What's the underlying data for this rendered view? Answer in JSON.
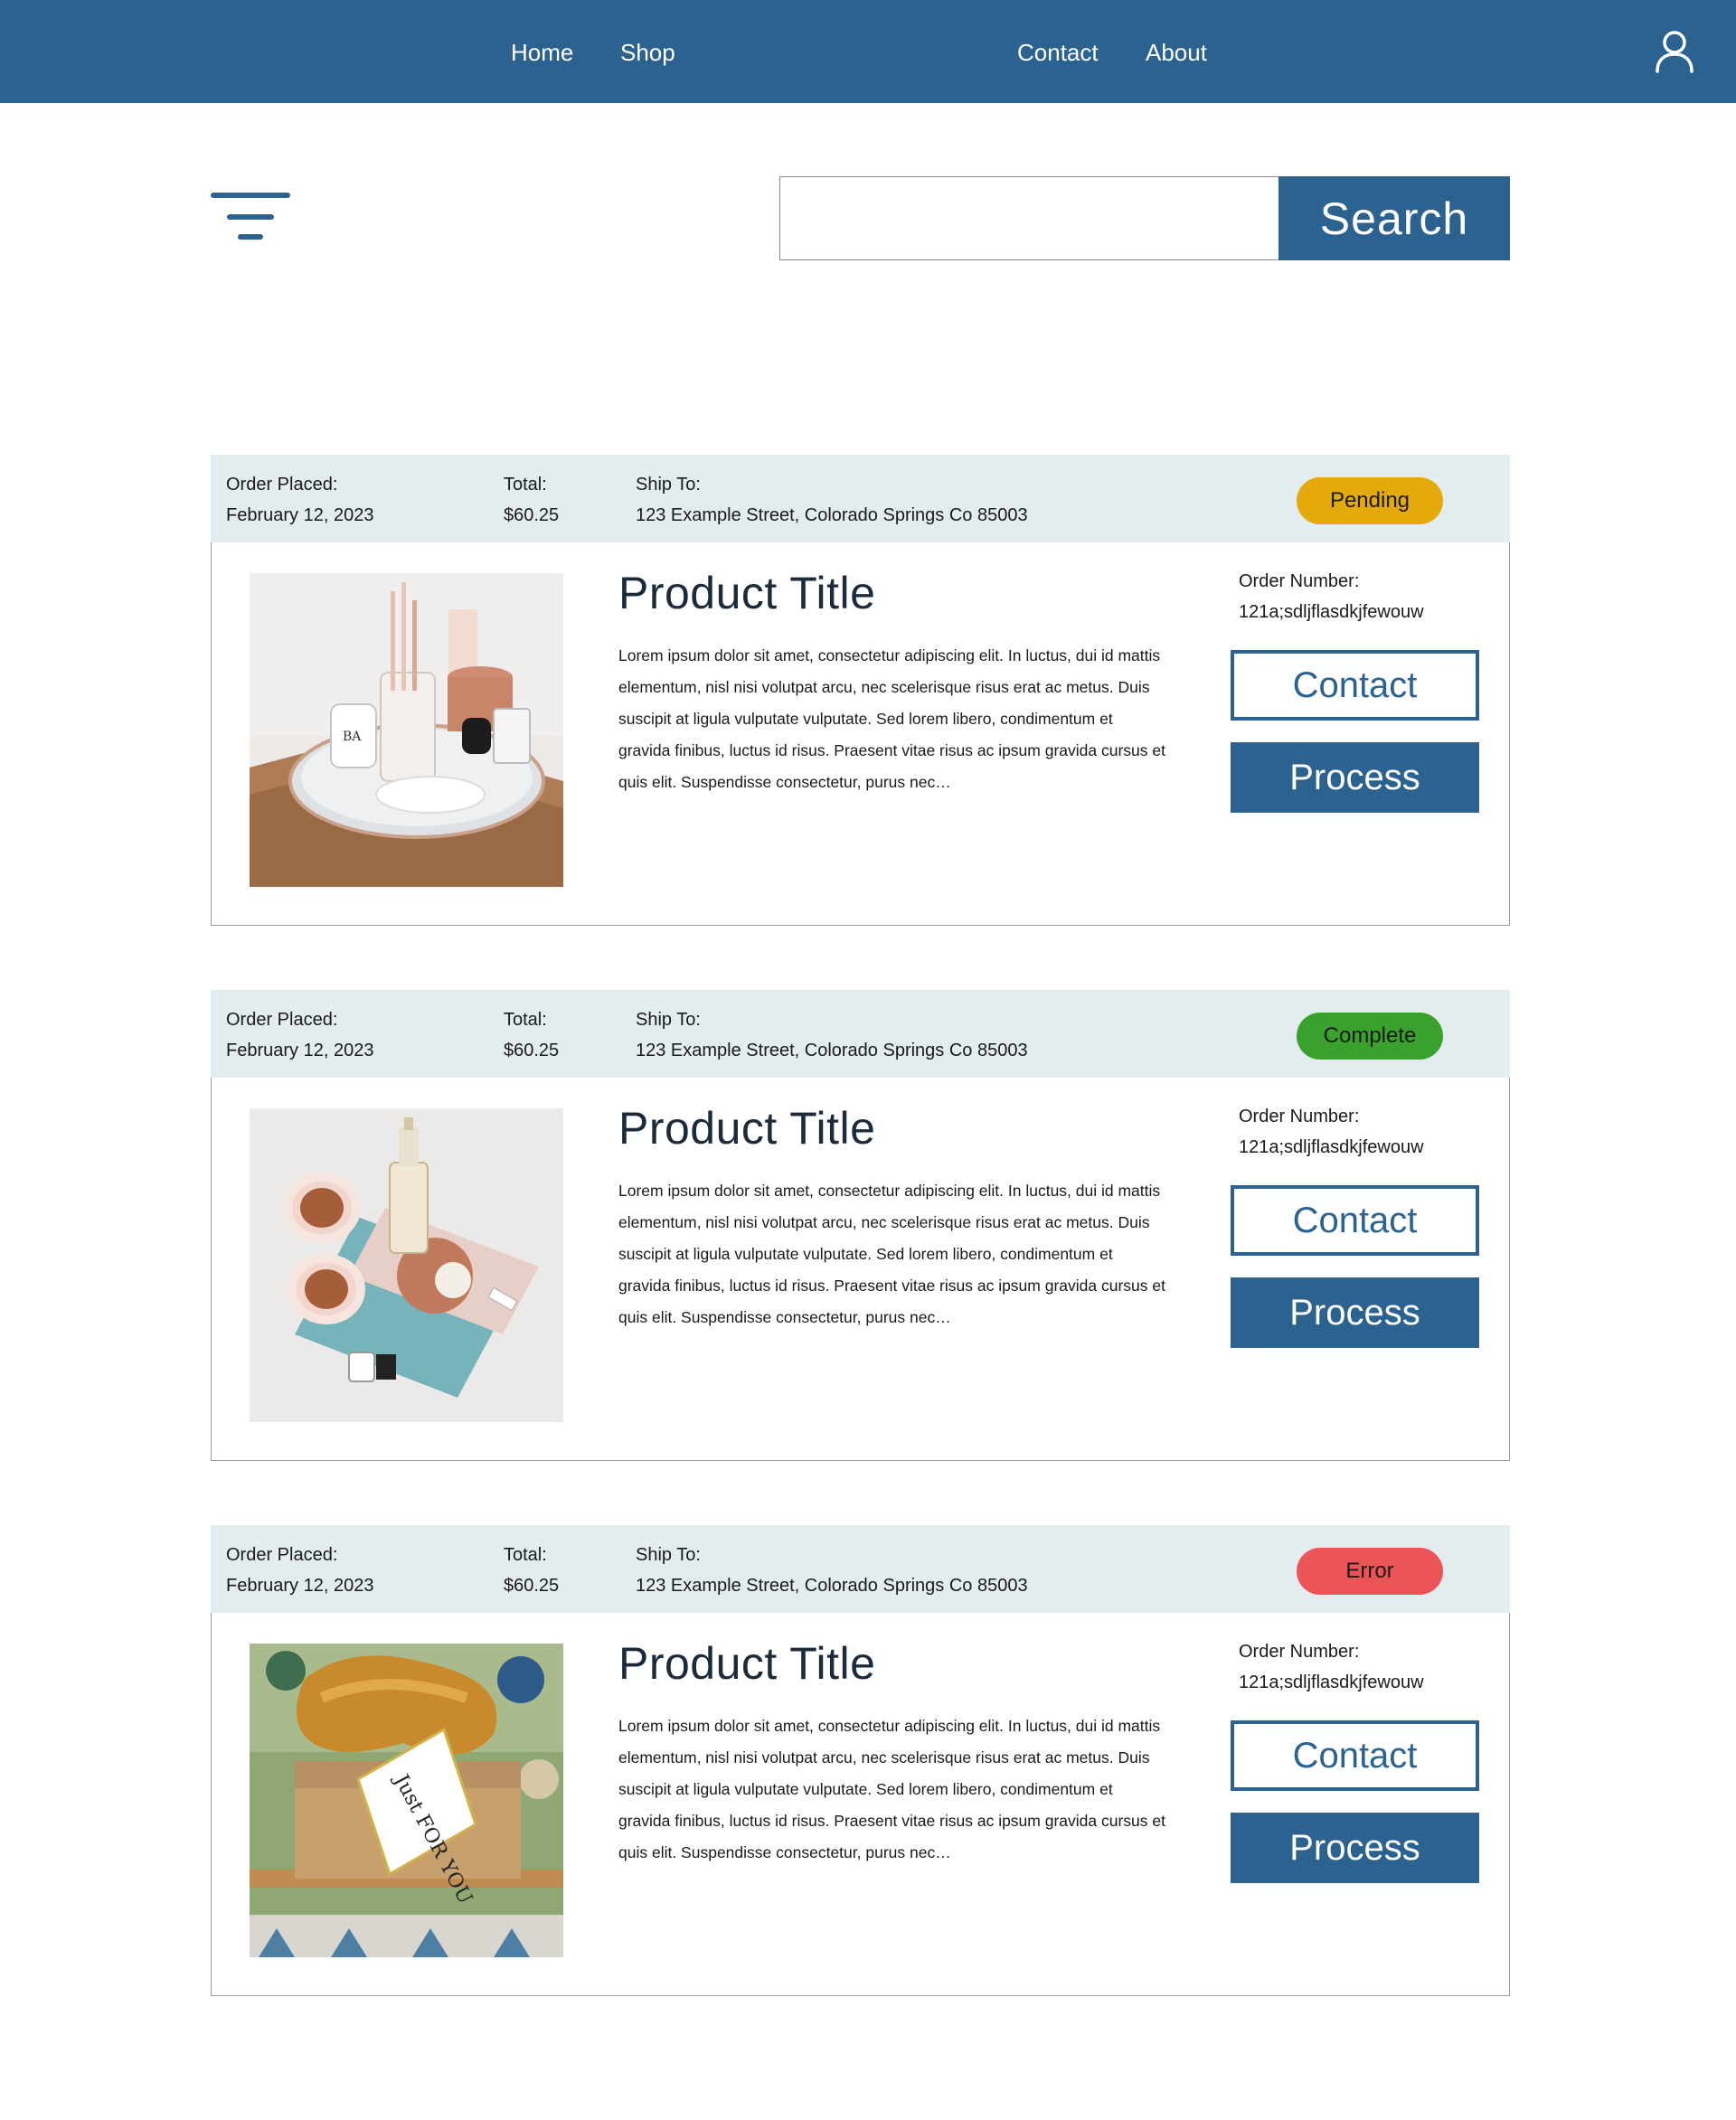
{
  "nav": {
    "links": [
      "Home",
      "Shop",
      "Contact",
      "About"
    ],
    "user_icon": "user-icon",
    "accent_color": "#2c6290"
  },
  "toolbar": {
    "filter_icon": "filter-icon",
    "search_value": "",
    "search_label": "Search"
  },
  "orders": [
    {
      "placed_label": "Order Placed:",
      "placed_date": "February 12, 2023",
      "total_label": "Total:",
      "total": "$60.25",
      "ship_label": "Ship To:",
      "ship_address": "123 Example Street, Colorado Springs Co 85003",
      "status": "Pending",
      "status_color": "#e4a90a",
      "title": "Product Title",
      "description": "Lorem ipsum dolor sit amet, consectetur adipiscing elit. In luctus, dui id mattis elementum, nisl nisi volutpat arcu, nec scelerisque risus erat ac metus. Duis suscipit at ligula vulputate vulputate. Sed lorem libero, condimentum et gravida finibus, luctus id risus. Praesent vitae risus ac ipsum gravida cursus et quis elit. Suspendisse consectetur, purus nec…",
      "order_number_label": "Order Number:",
      "order_number": "121a;sdljflasdkjfewouw",
      "contact_label": "Contact",
      "process_label": "Process",
      "image": "vanity-tray-photo"
    },
    {
      "placed_label": "Order Placed:",
      "placed_date": "February 12, 2023",
      "total_label": "Total:",
      "total": "$60.25",
      "ship_label": "Ship To:",
      "ship_address": "123 Example Street, Colorado Springs Co 85003",
      "status": "Complete",
      "status_color": "#3aa12c",
      "title": "Product Title",
      "description": "Lorem ipsum dolor sit amet, consectetur adipiscing elit. In luctus, dui id mattis elementum, nisl nisi volutpat arcu, nec scelerisque risus erat ac metus. Duis suscipit at ligula vulputate vulputate. Sed lorem libero, condimentum et gravida finibus, luctus id risus. Praesent vitae risus ac ipsum gravida cursus et quis elit. Suspendisse consectetur, purus nec…",
      "order_number_label": "Order Number:",
      "order_number": "121a;sdljflasdkjfewouw",
      "contact_label": "Contact",
      "process_label": "Process",
      "image": "sunglasses-flatlay-photo"
    },
    {
      "placed_label": "Order Placed:",
      "placed_date": "February 12, 2023",
      "total_label": "Total:",
      "total": "$60.25",
      "ship_label": "Ship To:",
      "ship_address": "123 Example Street, Colorado Springs Co 85003",
      "status": "Error",
      "status_color": "#ec5558",
      "title": "Product Title",
      "description": "Lorem ipsum dolor sit amet, consectetur adipiscing elit. In luctus, dui id mattis elementum, nisl nisi volutpat arcu, nec scelerisque risus erat ac metus. Duis suscipit at ligula vulputate vulputate. Sed lorem libero, condimentum et gravida finibus, luctus id risus. Praesent vitae risus ac ipsum gravida cursus et quis elit. Suspendisse consectetur, purus nec…",
      "order_number_label": "Order Number:",
      "order_number": "121a;sdljflasdkjfewouw",
      "contact_label": "Contact",
      "process_label": "Process",
      "image": "gift-box-photo",
      "image_tag_text": "Just FOR YOU"
    }
  ]
}
